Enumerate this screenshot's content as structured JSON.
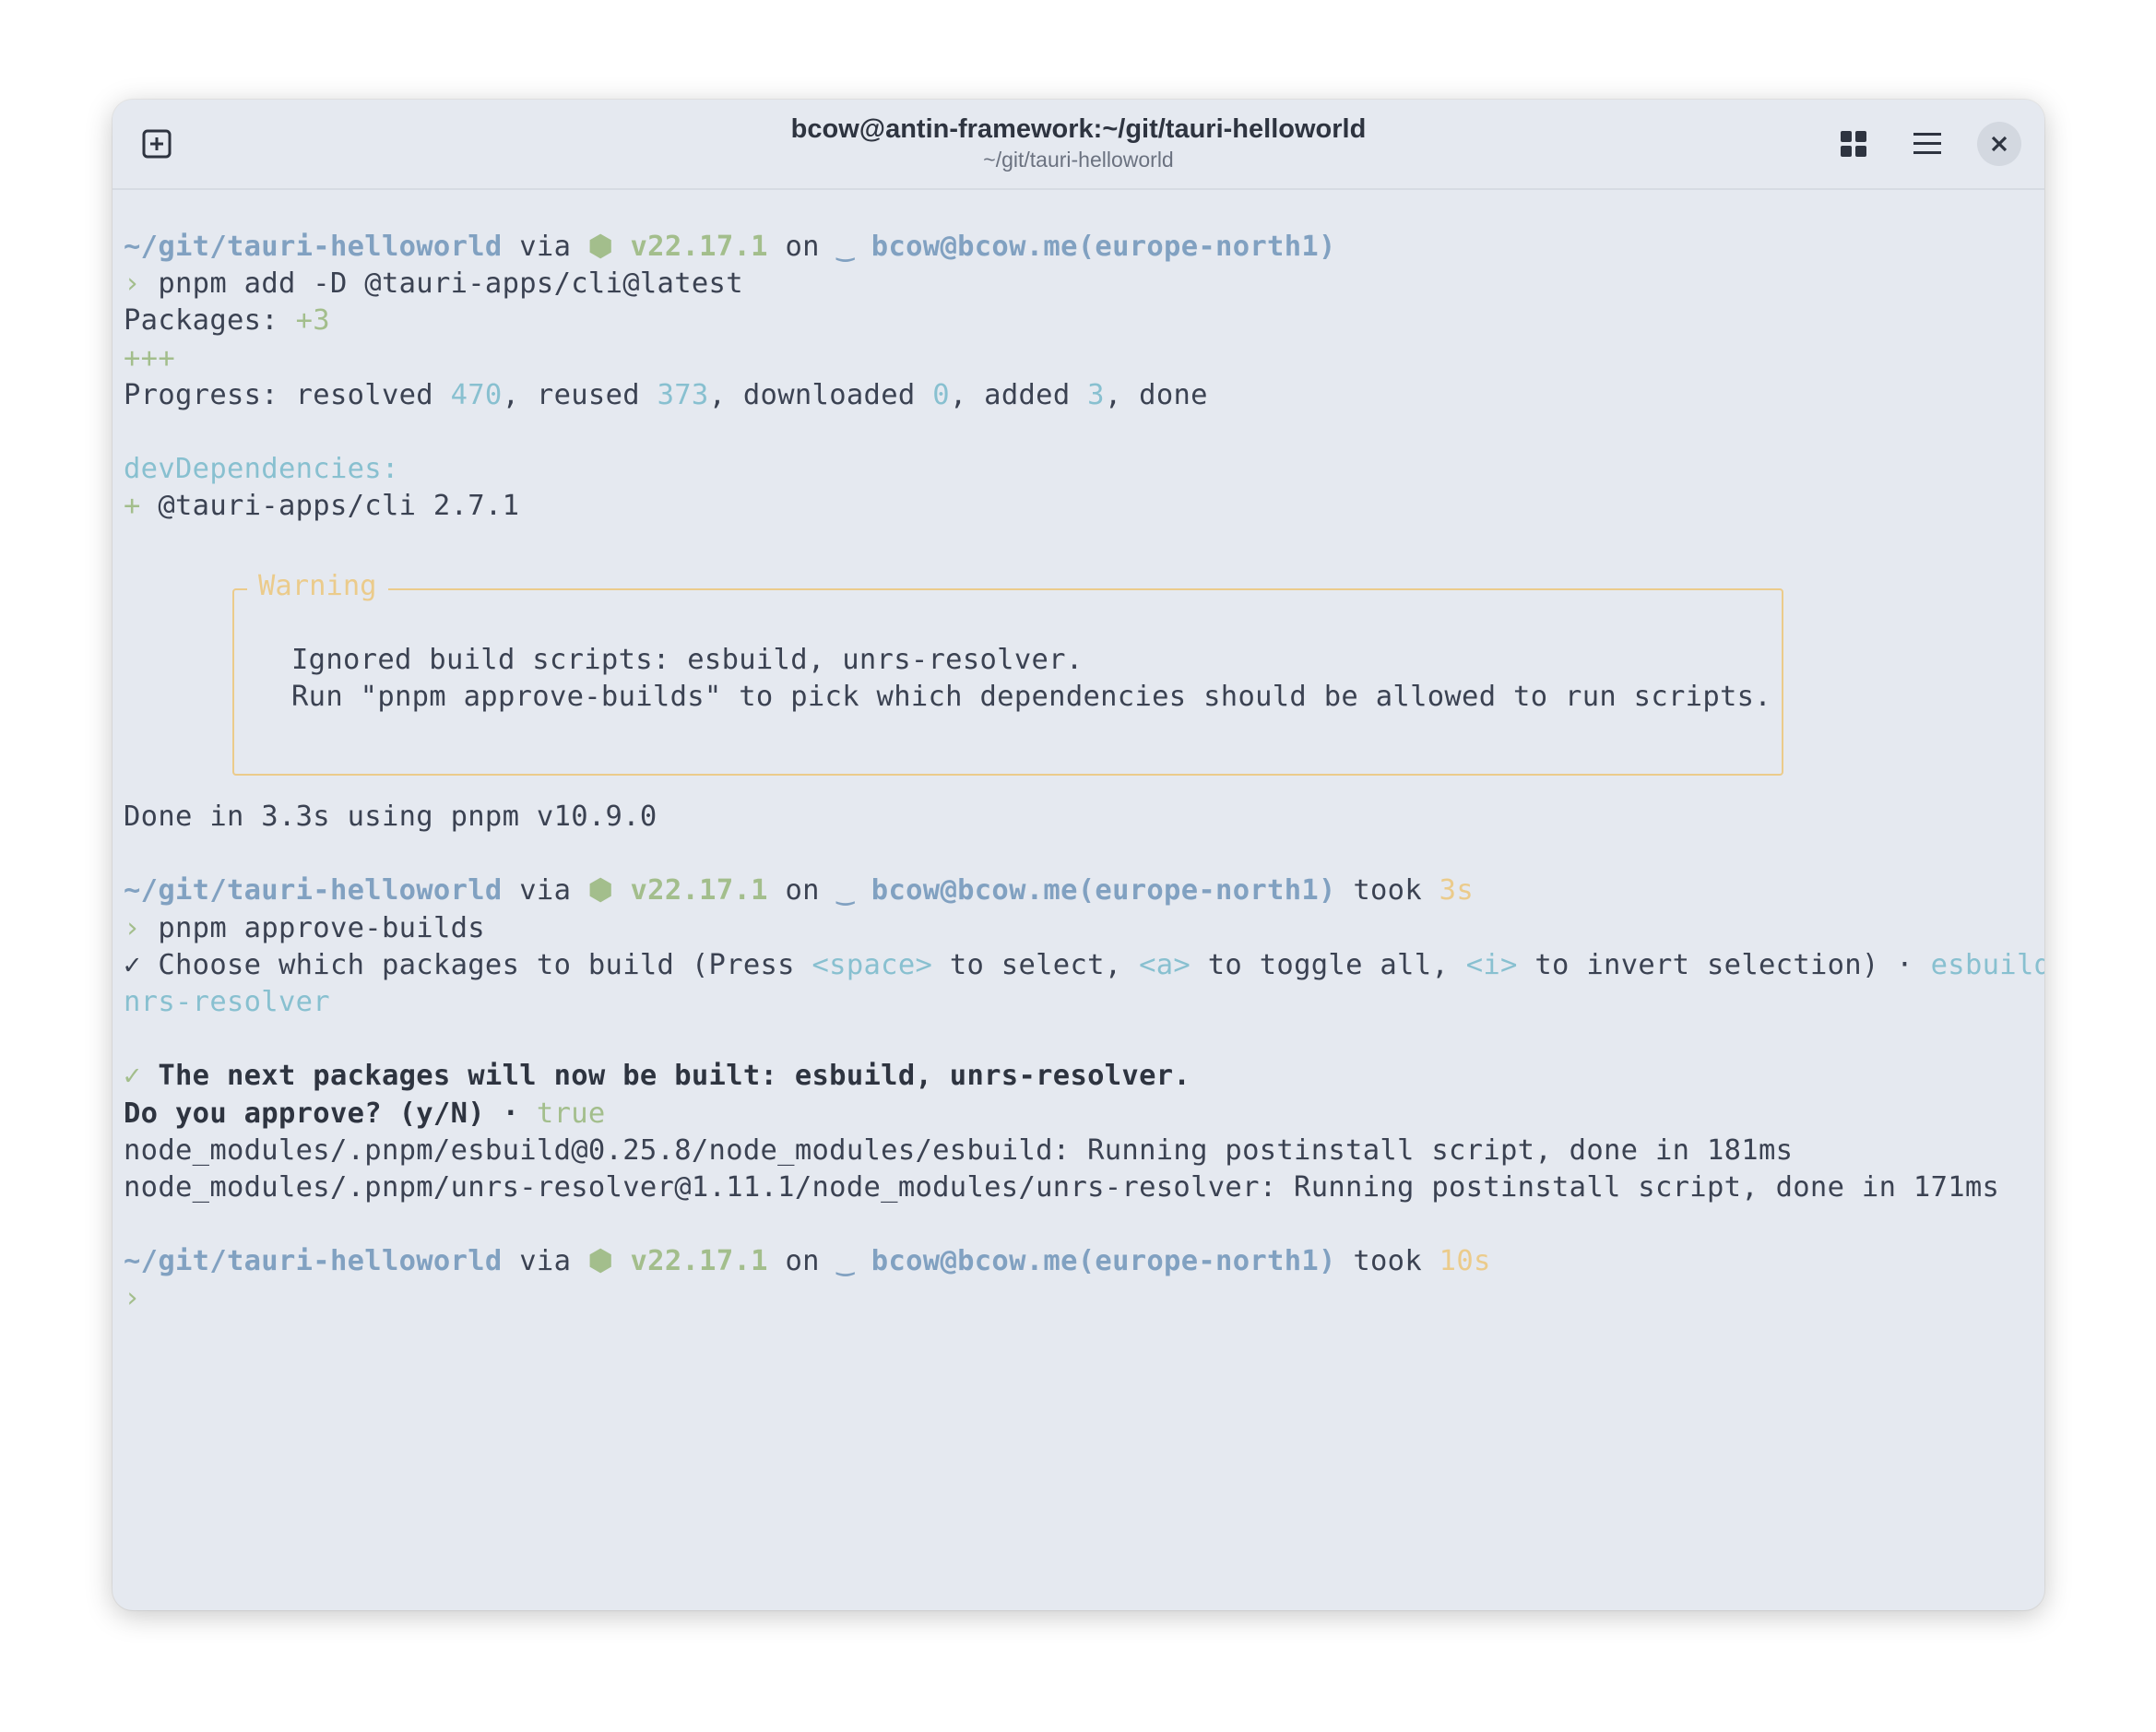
{
  "window": {
    "title": "bcow@antin-framework:~/git/tauri-helloworld",
    "subtitle": "~/git/tauri-helloworld"
  },
  "toolbar": {
    "new_tab_icon": "new-tab-icon",
    "grid_icon": "grid-icon",
    "menu_icon": "hamburger-menu-icon",
    "close_icon": "close-icon"
  },
  "prompt": {
    "path": "~/git/tauri-helloworld",
    "via": " via ",
    "node_version": "v22.17.1",
    "on": " on ",
    "cloud_account": "bcow@bcow.me(europe-north1)",
    "took": " took ",
    "arrow": "›"
  },
  "cmd1": {
    "command": "pnpm add -D @tauri-apps/cli@latest",
    "packages_label": "Packages: ",
    "packages_count": "+3",
    "plus_bar": "+++",
    "progress_label": "Progress: resolved ",
    "resolved": "470",
    "reused_label": ", reused ",
    "reused": "373",
    "downloaded_label": ", downloaded ",
    "downloaded": "0",
    "added_label": ", added ",
    "added": "3",
    "done_label": ", done",
    "devdeps_label": "devDependencies:",
    "dep_plus": "+",
    "dep_name": " @tauri-apps/cli 2.7.1",
    "warning_title": "Warning",
    "warning_line1": "Ignored build scripts: esbuild, unrs-resolver.",
    "warning_line2": "Run \"pnpm approve-builds\" to pick which dependencies should be allowed to run scripts.",
    "done_text": "Done in 3.3s using pnpm v10.9.0"
  },
  "cmd2": {
    "took_value": "3s",
    "command": "pnpm approve-builds",
    "check": "✓",
    "choose_a": " Choose which packages to build (Press ",
    "key_space": "<space>",
    "choose_b": " to select, ",
    "key_a": "<a>",
    "choose_c": " to toggle all, ",
    "key_i": "<i>",
    "choose_d": " to invert selection) · ",
    "selected_a": "esbuild, u",
    "selected_b": "nrs-resolver",
    "check2": "✓",
    "next_packages": " The next packages will now be built: esbuild, unrs-resolver.",
    "approve_q": "Do you approve? (y/N) · ",
    "approve_a": "true",
    "postinstall1": "node_modules/.pnpm/esbuild@0.25.8/node_modules/esbuild: Running postinstall script, done in 181ms",
    "postinstall2": "node_modules/.pnpm/unrs-resolver@1.11.1/node_modules/unrs-resolver: Running postinstall script, done in 171ms"
  },
  "cmd3": {
    "took_value": "10s"
  },
  "colors": {
    "background": "#e5e9f0",
    "text": "#3b4252",
    "path": "#81a1c1",
    "green": "#a3be8c",
    "cyan": "#88c0d0",
    "yellow": "#ebcb8b"
  }
}
